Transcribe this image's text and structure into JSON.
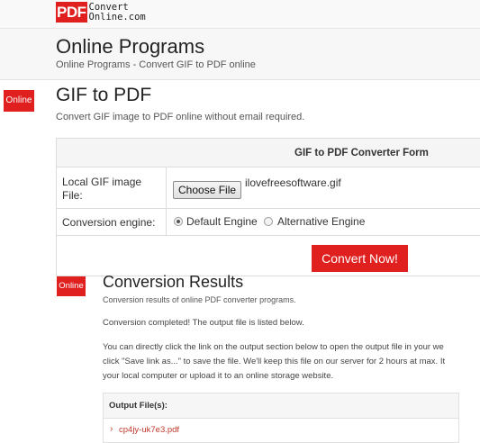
{
  "logo": {
    "mark": "PDF",
    "line1": "Convert",
    "line2": "Online.com"
  },
  "header": {
    "title": "Online Programs",
    "breadcrumb": "Online Programs - Convert GIF to PDF online"
  },
  "badge": {
    "label": "Online"
  },
  "section": {
    "title": "GIF to PDF",
    "subtitle": "Convert GIF image to PDF online without email required."
  },
  "form": {
    "heading": "GIF to PDF Converter Form",
    "file_label": "Local GIF image File:",
    "choose_button": "Choose File",
    "file_name": "ilovefreesoftware.gif",
    "engine_label": "Conversion engine:",
    "engine_options": [
      "Default Engine",
      "Alternative Engine"
    ],
    "engine_selected": "Default Engine"
  },
  "convert_button": "Convert Now!",
  "results": {
    "badge": "Online",
    "title": "Conversion Results",
    "subtitle": "Conversion results of online PDF converter programs.",
    "completed": "Conversion completed! The output file is listed below.",
    "para_lines": [
      "You can directly click the link on the output section below to open the output file in your we",
      "click \"Save link as...\" to save the file. We'll keep this file on our server for 2 hours at max. It",
      "your local computer or upload it to an online storage website."
    ],
    "output_heading": "Output File(s):",
    "output_file": "cp4jy-uk7e3.pdf"
  },
  "colors": {
    "accent": "#e01f1f",
    "link": "#c0392b"
  }
}
